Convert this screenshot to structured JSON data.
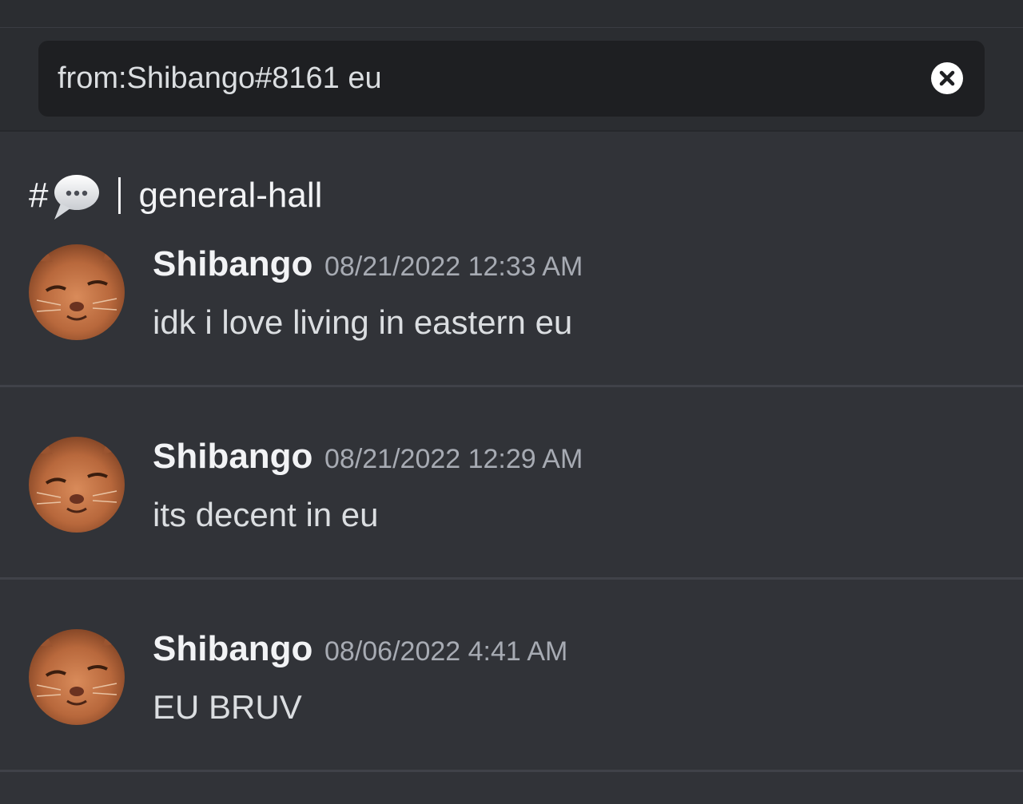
{
  "search": {
    "query": "from:Shibango#8161 eu",
    "clear_icon": "close-circle-icon"
  },
  "channel": {
    "hash": "#",
    "emoji_icon": "speech-bubble-icon",
    "name": "general-hall"
  },
  "messages": [
    {
      "author": "Shibango",
      "timestamp": "08/21/2022 12:33 AM",
      "text": "idk i love living in eastern eu",
      "avatar": "cat-avatar"
    },
    {
      "author": "Shibango",
      "timestamp": "08/21/2022 12:29 AM",
      "text": "its decent in eu",
      "avatar": "cat-avatar"
    },
    {
      "author": "Shibango",
      "timestamp": "08/06/2022 4:41 AM",
      "text": "EU BRUV",
      "avatar": "cat-avatar"
    }
  ],
  "colors": {
    "background": "#313338",
    "header_background": "#2b2d31",
    "search_background": "#1e1f22",
    "username": "#f2f3f5",
    "timestamp": "#a7abb3"
  }
}
